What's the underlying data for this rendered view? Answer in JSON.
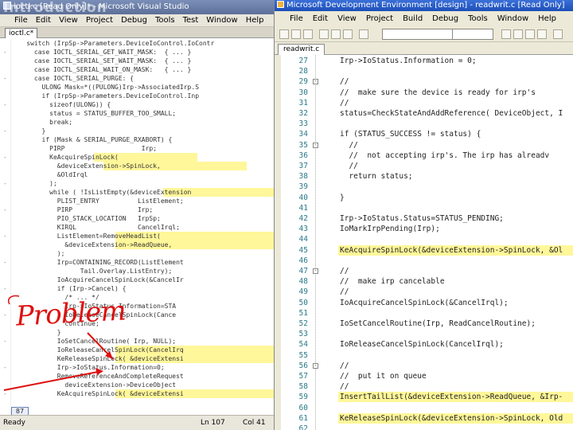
{
  "overlay": {
    "title": "Introduction",
    "annotation": "Problem",
    "annotation_color": "#d11111",
    "highlight_color": "#fff79a"
  },
  "left_window": {
    "title": "ioctl.c [Read Only]* - Microsoft Visual Studio",
    "menu": [
      "File",
      "Edit",
      "View",
      "Project",
      "Debug",
      "Tools",
      "Test",
      "Window",
      "Help"
    ],
    "tab": "ioctl.c*",
    "code_lines": [
      {
        "text": "    switch (IrpSp->Parameters.DeviceIoControl.IoContr",
        "hl": null
      },
      {
        "text": "      case IOCTL_SERIAL_GET_WAIT_MASK:  { ... }",
        "hl": null
      },
      {
        "text": "      case IOCTL_SERIAL_SET_WAIT_MASK:  { ... }",
        "hl": null
      },
      {
        "text": "      case IOCTL_SERIAL_WAIT_ON_MASK:   { ... }",
        "hl": null
      },
      {
        "text": "      case IOCTL_SERIAL_PURGE: {",
        "hl": null
      },
      {
        "text": "        ULONG Mask=*((PULONG)Irp->AssociatedIrp.S",
        "hl": null
      },
      {
        "text": "        if (IrpSp->Parameters.DeviceIoControl.Inp",
        "hl": null
      },
      {
        "text": "          sizeof(ULONG)) {",
        "hl": null
      },
      {
        "text": "          status = STATUS_BUFFER_TOO_SMALL;",
        "hl": null
      },
      {
        "text": "          break;",
        "hl": null
      },
      {
        "text": "        }",
        "hl": null
      },
      {
        "text": "        if (Mask & SERIAL_PURGE_RXABORT) {",
        "hl": null
      },
      {
        "text": "          PIRP                    Irp;",
        "hl": null
      },
      {
        "text": "          KeAcquireSpinLock(",
        "hl": [
          118,
          130
        ]
      },
      {
        "text": "            &deviceExtension->SpinLock,",
        "hl": [
          130,
          180
        ]
      },
      {
        "text": "            &OldIrql",
        "hl": null
      },
      {
        "text": "          );",
        "hl": null
      },
      {
        "text": "          while ( !IsListEmpty(&deviceExtension",
        "hl": [
          205,
          140
        ]
      },
      {
        "text": "            PLIST_ENTRY          ListElement;",
        "hl": null
      },
      {
        "text": "            PIRP                 Irp;",
        "hl": null
      },
      {
        "text": "            PIO_STACK_LOCATION   IrpSp;",
        "hl": null
      },
      {
        "text": "            KIRQL                CancelIrql;",
        "hl": null
      },
      {
        "text": "            ListElement=RemoveHeadList(",
        "hl": [
          145,
          200
        ]
      },
      {
        "text": "              &deviceExtension->ReadQueue,",
        "hl": [
          145,
          200
        ]
      },
      {
        "text": "            );",
        "hl": null
      },
      {
        "text": "            Irp=CONTAINING_RECORD(ListElement",
        "hl": null
      },
      {
        "text": "                  Tail.Overlay.ListEntry);",
        "hl": null
      },
      {
        "text": "            IoAcquireCancelSpinLock(&CancelIr",
        "hl": null
      },
      {
        "text": "            if (Irp->Cancel) {",
        "hl": null
      },
      {
        "text": "              /* ... */",
        "hl": null
      },
      {
        "text": "              Irp->IoStatus.Information=STA",
        "hl": null
      },
      {
        "text": "              IoReleaseCancelSpinLock(Cance",
        "hl": null
      },
      {
        "text": "              continue;",
        "hl": null
      },
      {
        "text": "            }",
        "hl": null
      },
      {
        "text": "            IoSetCancelRoutine( Irp, NULL);",
        "hl": null
      },
      {
        "text": "            IoReleaseCancelSpinLock(CancelIrq",
        "hl": [
          145,
          200
        ]
      },
      {
        "text": "            KeReleaseSpinLock( &deviceExtensi",
        "hl": [
          145,
          200
        ]
      },
      {
        "text": "            Irp->IoStatus.Information=0;",
        "hl": null
      },
      {
        "text": "            RemoveReferenceAndCompleteRequest",
        "hl": null
      },
      {
        "text": "              deviceExtension->DeviceObject",
        "hl": null
      },
      {
        "text": "            KeAcquireSpinLock( &deviceExtensi",
        "hl": [
          145,
          200
        ]
      }
    ],
    "status": {
      "ready": "Ready",
      "line_num": "87",
      "ln": "Ln 107",
      "col": "Col 41"
    }
  },
  "right_window": {
    "title": "Microsoft Development Environment [design] - readwrit.c [Read Only]",
    "menu": [
      "File",
      "Edit",
      "View",
      "Project",
      "Build",
      "Debug",
      "Tools",
      "Window",
      "Help"
    ],
    "tab": "readwrit.c",
    "code_lines": [
      {
        "n": "27",
        "text": "Irp->IoStatus.Information = 0;",
        "fold": null,
        "hl": false
      },
      {
        "n": "28",
        "text": "",
        "fold": null,
        "hl": false
      },
      {
        "n": "29",
        "text": "//",
        "fold": "-",
        "hl": false
      },
      {
        "n": "30",
        "text": "//  make sure the device is ready for irp's",
        "fold": null,
        "hl": false
      },
      {
        "n": "31",
        "text": "//",
        "fold": null,
        "hl": false
      },
      {
        "n": "32",
        "text": "status=CheckStateAndAddReference( DeviceObject, I",
        "fold": null,
        "hl": false
      },
      {
        "n": "33",
        "text": "",
        "fold": null,
        "hl": false
      },
      {
        "n": "34",
        "text": "if (STATUS_SUCCESS != status) {",
        "fold": null,
        "hl": false
      },
      {
        "n": "35",
        "text": "  //",
        "fold": "-",
        "hl": false
      },
      {
        "n": "36",
        "text": "  //  not accepting irp's. The irp has alreadv",
        "fold": null,
        "hl": false
      },
      {
        "n": "37",
        "text": "  //",
        "fold": null,
        "hl": false
      },
      {
        "n": "38",
        "text": "  return status;",
        "fold": null,
        "hl": false
      },
      {
        "n": "39",
        "text": "",
        "fold": null,
        "hl": false
      },
      {
        "n": "40",
        "text": "}",
        "fold": null,
        "hl": false
      },
      {
        "n": "41",
        "text": "",
        "fold": null,
        "hl": false
      },
      {
        "n": "42",
        "text": "Irp->IoStatus.Status=STATUS_PENDING;",
        "fold": null,
        "hl": false
      },
      {
        "n": "43",
        "text": "IoMarkIrpPending(Irp);",
        "fold": null,
        "hl": false
      },
      {
        "n": "44",
        "text": "",
        "fold": null,
        "hl": false
      },
      {
        "n": "45",
        "text": "KeAcquireSpinLock(&deviceExtension->SpinLock, &Ol",
        "fold": null,
        "hl": true
      },
      {
        "n": "46",
        "text": "",
        "fold": null,
        "hl": false
      },
      {
        "n": "47",
        "text": "//",
        "fold": "-",
        "hl": false
      },
      {
        "n": "48",
        "text": "//  make irp cancelable",
        "fold": null,
        "hl": false
      },
      {
        "n": "49",
        "text": "//",
        "fold": null,
        "hl": false
      },
      {
        "n": "50",
        "text": "IoAcquireCancelSpinLock(&CancelIrql);",
        "fold": null,
        "hl": false
      },
      {
        "n": "51",
        "text": "",
        "fold": null,
        "hl": false
      },
      {
        "n": "52",
        "text": "IoSetCancelRoutine(Irp, ReadCancelRoutine);",
        "fold": null,
        "hl": false
      },
      {
        "n": "53",
        "text": "",
        "fold": null,
        "hl": false
      },
      {
        "n": "54",
        "text": "IoReleaseCancelSpinLock(CancelIrql);",
        "fold": null,
        "hl": false
      },
      {
        "n": "55",
        "text": "",
        "fold": null,
        "hl": false
      },
      {
        "n": "56",
        "text": "//",
        "fold": "-",
        "hl": false
      },
      {
        "n": "57",
        "text": "//  put it on queue",
        "fold": null,
        "hl": false
      },
      {
        "n": "58",
        "text": "//",
        "fold": null,
        "hl": false
      },
      {
        "n": "59",
        "text": "InsertTailList(&deviceExtension->ReadQueue, &Irp-",
        "fold": null,
        "hl": true
      },
      {
        "n": "60",
        "text": "",
        "fold": null,
        "hl": false
      },
      {
        "n": "61",
        "text": "KeReleaseSpinLock(&deviceExtension->SpinLock, Old",
        "fold": null,
        "hl": true
      },
      {
        "n": "62",
        "text": "",
        "fold": null,
        "hl": false
      }
    ]
  }
}
